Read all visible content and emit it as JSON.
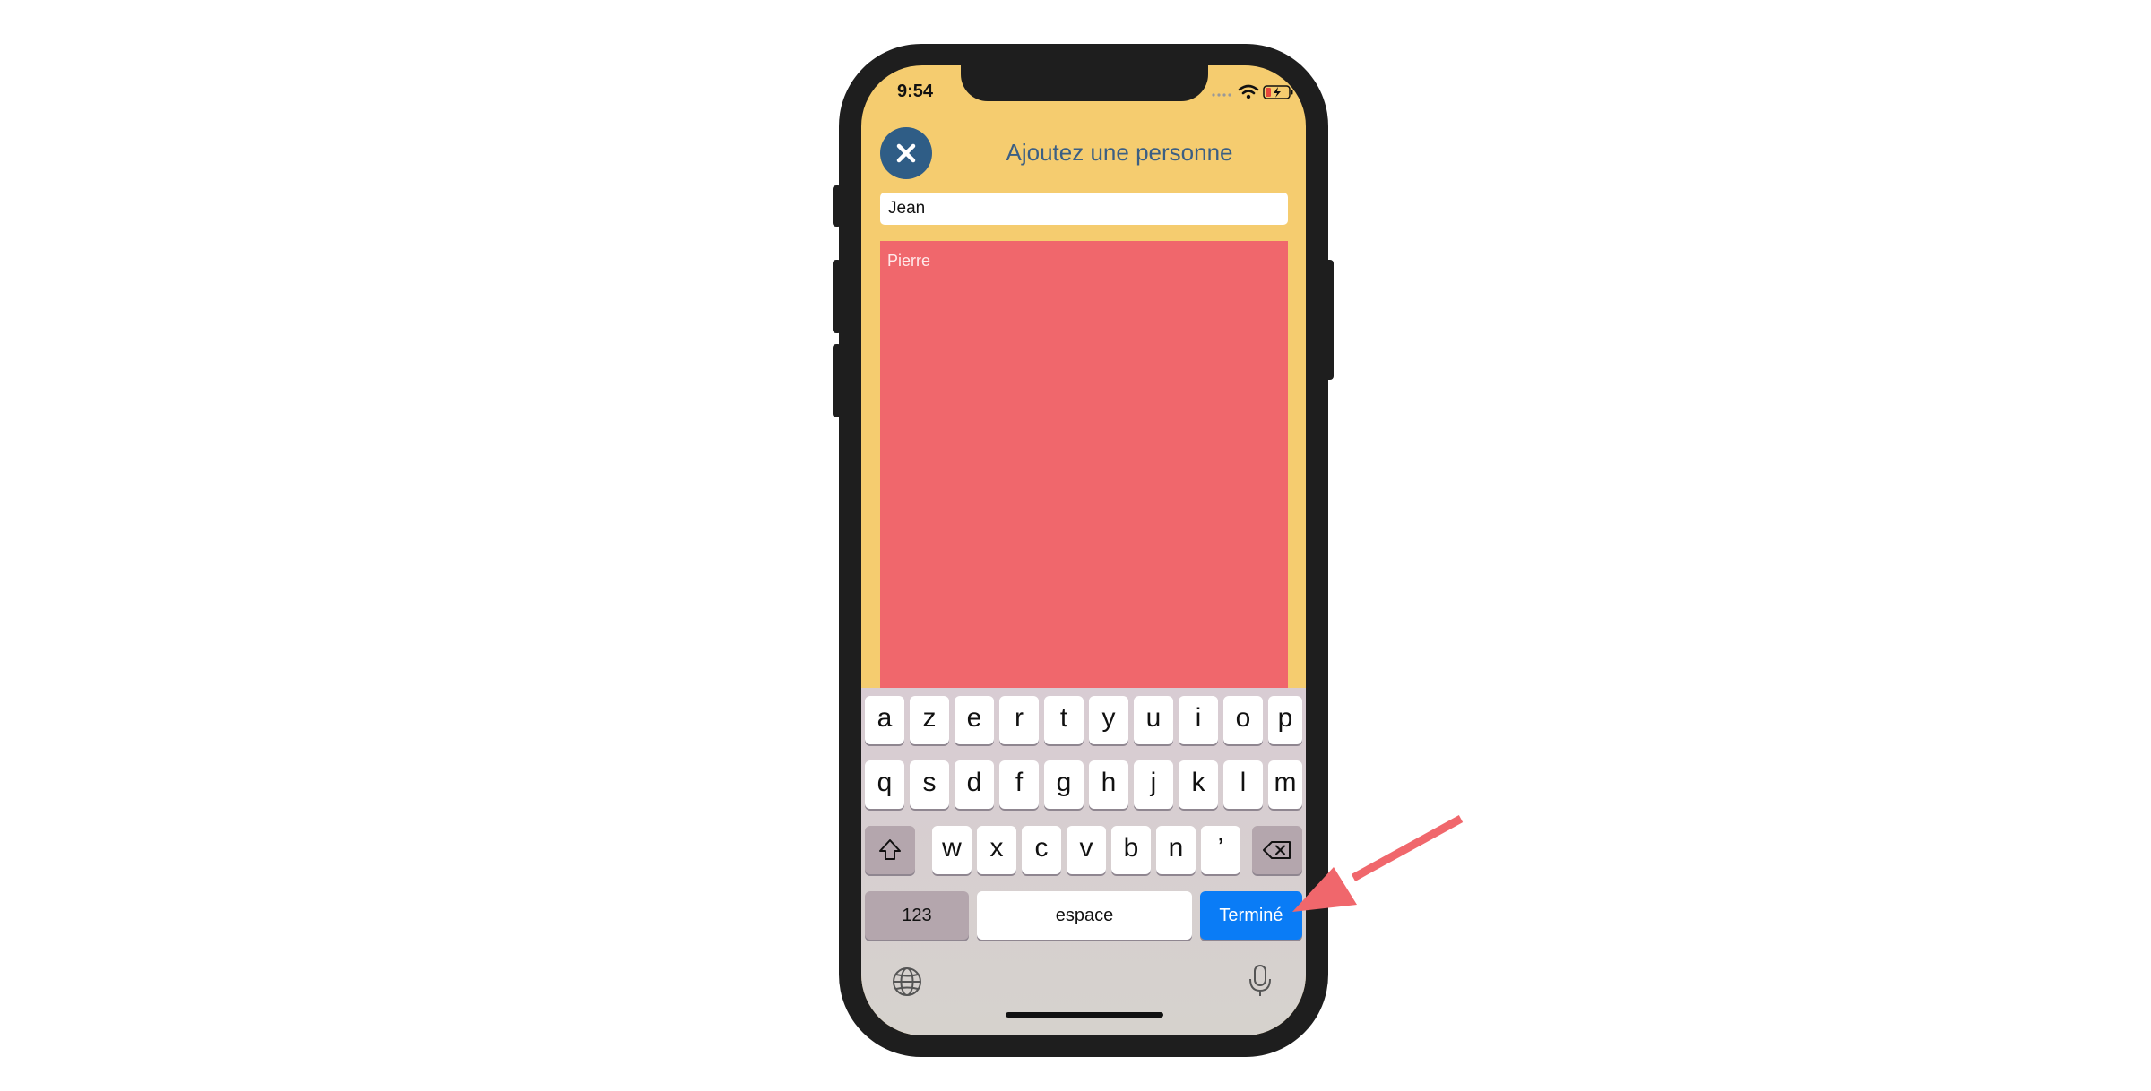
{
  "status_bar": {
    "time": "9:54",
    "icons": [
      "cellular-icon",
      "wifi-icon",
      "battery-charging-icon"
    ]
  },
  "header": {
    "close_icon": "close-icon",
    "title": "Ajoutez une personne"
  },
  "form": {
    "first_name_value": "Jean",
    "text_value": "Pierre"
  },
  "keyboard": {
    "row1": [
      "a",
      "z",
      "e",
      "r",
      "t",
      "y",
      "u",
      "i",
      "o",
      "p"
    ],
    "row2": [
      "q",
      "s",
      "d",
      "f",
      "g",
      "h",
      "j",
      "k",
      "l",
      "m"
    ],
    "row3": [
      "w",
      "x",
      "c",
      "v",
      "b",
      "n",
      "’"
    ],
    "numbers_label": "123",
    "space_label": "espace",
    "done_label": "Terminé",
    "icons": [
      "shift-icon",
      "backspace-icon",
      "globe-icon",
      "microphone-icon"
    ]
  },
  "annotation": {
    "arrow_color": "#f0676c",
    "points_to": "done-key"
  },
  "colors": {
    "screen_background": "#f5cc6f",
    "close_button": "#2f5d86",
    "title_text": "#3b5f84",
    "text_area": "#f0676c",
    "done_key": "#0a7cf6"
  }
}
